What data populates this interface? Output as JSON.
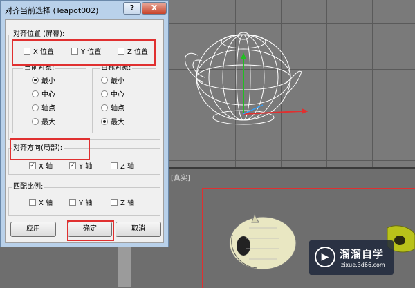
{
  "dialog": {
    "title": "对齐当前选择 (Teapot002)",
    "help_label": "?",
    "close_label": "X",
    "position_group": {
      "title": "对齐位置 (屏幕):",
      "x_label": "X 位置",
      "y_label": "Y 位置",
      "z_label": "Z 位置",
      "x_checked": false,
      "y_checked": false,
      "z_checked": false
    },
    "current_object": {
      "title": "当前对象:",
      "options": [
        "最小",
        "中心",
        "轴点",
        "最大"
      ],
      "selected": "最小"
    },
    "target_object": {
      "title": "目标对象:",
      "options": [
        "最小",
        "中心",
        "轴点",
        "最大"
      ],
      "selected": "最大"
    },
    "orientation_group": {
      "title": "对齐方向(局部):",
      "x_label": "X 轴",
      "y_label": "Y 轴",
      "z_label": "Z 轴",
      "x_checked": true,
      "y_checked": true,
      "z_checked": false
    },
    "scale_group": {
      "title": "匹配比例:",
      "x_label": "X 轴",
      "y_label": "Y 轴",
      "z_label": "Z 轴",
      "x_checked": false,
      "y_checked": false,
      "z_checked": false
    },
    "apply_label": "应用",
    "ok_label": "确定",
    "cancel_label": "取消"
  },
  "viewport": {
    "bottom_label": "[真实]"
  },
  "watermark": {
    "title": "溜溜自学",
    "url": "zixue.3d66.com"
  },
  "colors": {
    "highlight_red": "#e03030",
    "dialog_frame": "#b9d1ea",
    "dialog_body": "#f0f0f0"
  }
}
